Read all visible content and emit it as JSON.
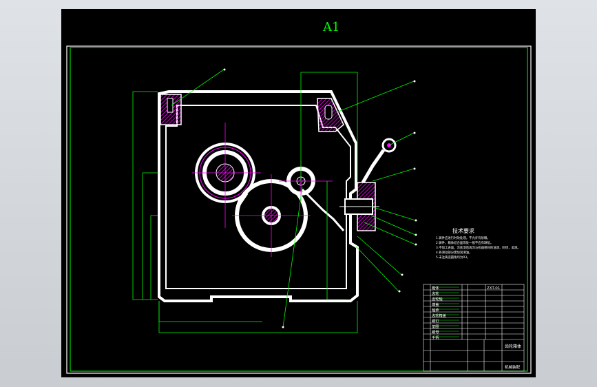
{
  "sheet": {
    "size_label": "A1"
  },
  "technical_requirements": {
    "title": "技术要求",
    "items": [
      "1.铸件应进行时效处理，不允许有砂眼。",
      "2.铸件，箱体结合面等处一般不应有缺陷。",
      "3.不加工表面，涂底漆后再涂与机器相同的油漆，防锈，美观。",
      "4.各滑动部分需加润滑油。",
      "5.未注铸造圆角均为R3。"
    ]
  },
  "title_block": {
    "drawing_name": "齿轮箱体",
    "drawing_code": "ZXT-01",
    "unit": "机械装配",
    "rows": [
      "箱体",
      "齿轮",
      "齿轮轴",
      "端盖",
      "轴承",
      "齿轮箱盖",
      "螺钉",
      "垫圈",
      "螺母",
      "手柄"
    ]
  },
  "colors": {
    "frame": "#00ff00",
    "part_outline": "#ffffff",
    "hatch": "#ff00ff",
    "leader": "#00ff00",
    "viewport_bg": "#d6d9dd"
  }
}
